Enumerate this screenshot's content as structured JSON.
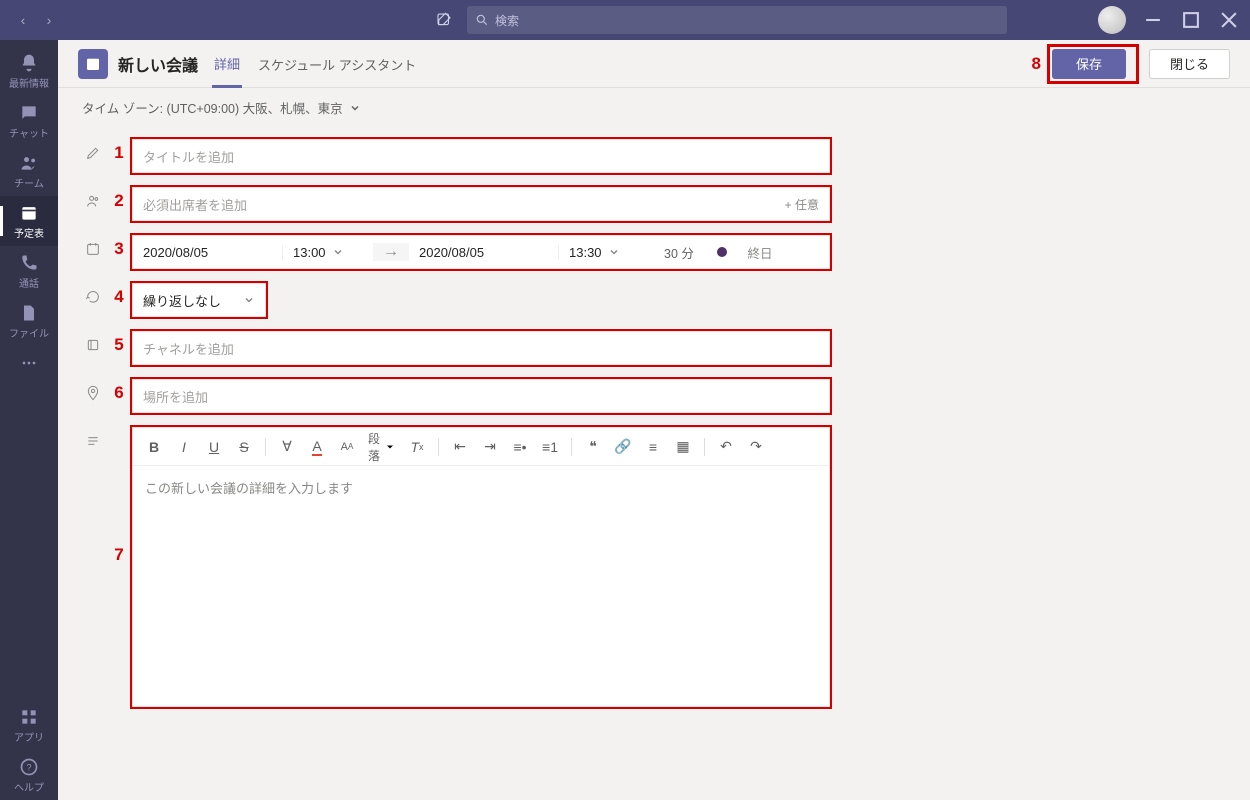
{
  "titlebar": {
    "search_placeholder": "検索"
  },
  "rail": {
    "activity": "最新情報",
    "chat": "チャット",
    "teams": "チーム",
    "calendar": "予定表",
    "calls": "通話",
    "files": "ファイル",
    "apps": "アプリ",
    "help": "ヘルプ"
  },
  "header": {
    "title": "新しい会議",
    "tab_details": "詳細",
    "tab_assistant": "スケジュール アシスタント",
    "save": "保存",
    "close": "閉じる"
  },
  "timezone": {
    "label": "タイム ゾーン: (UTC+09:00) 大阪、札幌、東京"
  },
  "fields": {
    "title_ph": "タイトルを追加",
    "attendees_ph": "必須出席者を追加",
    "optional": "+ 任意",
    "start_date": "2020/08/05",
    "start_time": "13:00",
    "end_date": "2020/08/05",
    "end_time": "13:30",
    "duration": "30 分",
    "allday": "終日",
    "recurrence": "繰り返しなし",
    "channel_ph": "チャネルを追加",
    "location_ph": "場所を追加",
    "details_ph": "この新しい会議の詳細を入力します",
    "paragraph": "段落"
  },
  "annotations": [
    "1",
    "2",
    "3",
    "4",
    "5",
    "6",
    "7",
    "8"
  ]
}
